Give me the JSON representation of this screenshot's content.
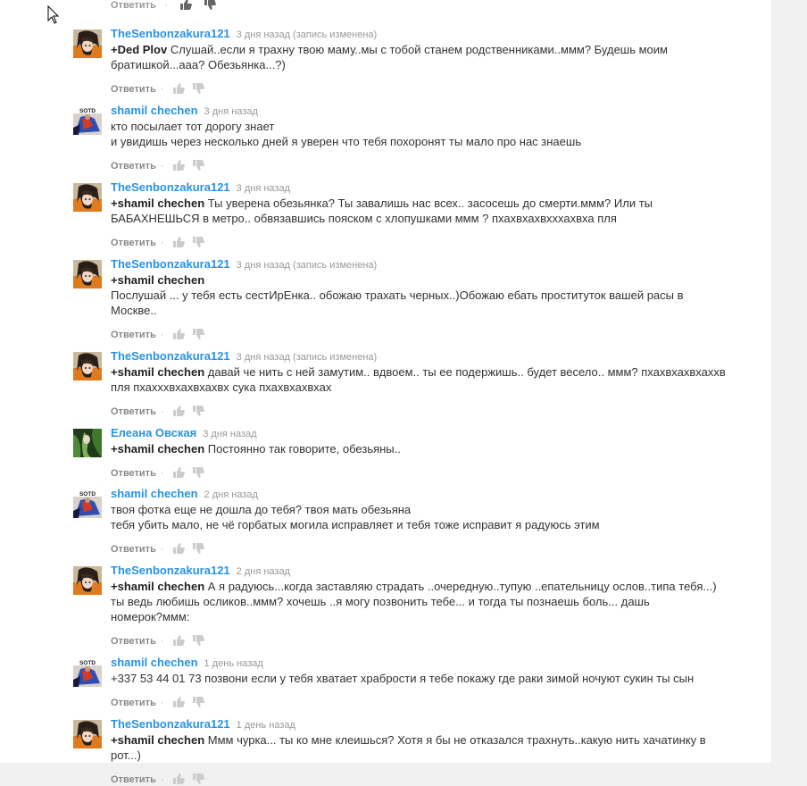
{
  "colors": {
    "author": "#2793e6",
    "reply": "#888888",
    "date": "#999999",
    "text": "#333333"
  },
  "actions": {
    "reply_label": "Ответить",
    "separator": "·"
  },
  "comments": [
    {
      "author": "TheSenbonzakura121",
      "date": "3 дня назад (запись изменена)",
      "avatar": "anime-avatar",
      "mention": "+Ded Plov",
      "lines": [
        "Слушай..если я  трахну твою  маму..мы с тобой станем  родственниками..ммм?  Будешь моим",
        "братишкой...ааа?  Обезьянка...?)"
      ]
    },
    {
      "author": "shamil chechen",
      "date": "3 дня назад",
      "avatar": "sotd-avatar",
      "mention": "",
      "lines": [
        "кто посылает тот дорогу знает",
        "и увидишь через несколько дней я уверен что тебя похоронят ты мало про нас знаешь"
      ]
    },
    {
      "author": "TheSenbonzakura121",
      "date": "3 дня назад",
      "avatar": "anime-avatar",
      "mention": "+shamil chechen",
      "lines": [
        "Ты уверена обезьянка?  Ты  завалишь  нас всех.. засосешь до смерти.ммм? Или ты",
        "БАБАХНЕШЬСЯ  в метро.. обвязавшись  пояском с хлопушками  ммм ? пхахвхахвхххахвха пля"
      ]
    },
    {
      "author": "TheSenbonzakura121",
      "date": "3 дня назад (запись изменена)",
      "avatar": "anime-avatar",
      "mention": "+shamil chechen",
      "lines": [
        "",
        "Послушай  ... у тебя есть сестИрЕнка.. обожаю  трахать   черных..)Обожаю ебать  проституток вашей расы  в",
        "Москве.."
      ]
    },
    {
      "author": "TheSenbonzakura121",
      "date": "3 дня назад (запись изменена)",
      "avatar": "anime-avatar",
      "mention": "+shamil chechen",
      "lines": [
        "давай че нить с ней замутим.. вдвоем.. ты ее подержишь.. будет весело.. ммм? пхахвхахвхаххв",
        "пля пхахххвхахвхахвх сука пхахвхахвхах"
      ]
    },
    {
      "author": "Елеана Овская",
      "date": "3 дня назад",
      "avatar": "green-avatar",
      "mention": "+shamil chechen",
      "lines": [
        "Постоянно так говорите, обезьяны.."
      ]
    },
    {
      "author": "shamil chechen",
      "date": "2 дня назад",
      "avatar": "sotd-avatar",
      "mention": "",
      "lines": [
        "твоя фотка еще не дошла до тебя? твоя мать обезьяна",
        "тебя убить мало, не чё горбатых могила исправляет и тебя тоже исправит я радуюсь этим"
      ]
    },
    {
      "author": "TheSenbonzakura121",
      "date": "2 дня назад",
      "avatar": "anime-avatar",
      "mention": "+shamil chechen",
      "lines": [
        "А я  радуюсь...когда заставляю  страдать  ..очередную..тупую    ..епательницу  ослов..типа тебя...)",
        "ты ведь   любишь осликов..ммм?  хочешь ..я могу позвонить тебе... и тогда  ты  познаешь   боль... дашь",
        "номерок?ммм:"
      ]
    },
    {
      "author": "shamil chechen",
      "date": "1 день назад",
      "avatar": "sotd-avatar",
      "mention": "",
      "lines": [
        "+337 53 44 01 73 позвони если у тебя хватает храбрости я тебе покажу где раки зимой ночуют сукин ты сын"
      ]
    },
    {
      "author": "TheSenbonzakura121",
      "date": "1 день назад",
      "avatar": "anime-avatar",
      "mention": "+shamil chechen",
      "lines": [
        "Ммм  чурка...  ты  ко мне клеишься?  Хотя   я бы не отказался  трахнуть..какую нить хачатинку  в",
        "рот...)"
      ]
    }
  ]
}
